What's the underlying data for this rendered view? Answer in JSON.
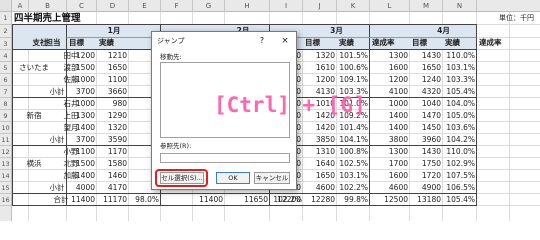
{
  "columns": [
    "A",
    "B",
    "C",
    "D",
    "E",
    "F",
    "G",
    "H",
    "I",
    "J",
    "K",
    "L",
    "M",
    "N"
  ],
  "row_numbers": [
    "1",
    "2",
    "3",
    "4",
    "5",
    "6",
    "7",
    "8",
    "9",
    "10",
    "11",
    "12",
    "13",
    "14",
    "15",
    "16"
  ],
  "sheet": {
    "title": "四半期売上管理",
    "unit": "単位：千円",
    "headers": {
      "branch": "支社",
      "person": "担当",
      "months": [
        "1月",
        "2月",
        "3月",
        "4月"
      ],
      "target": "目標",
      "actual": "実績",
      "rate": "達成率"
    },
    "rows": [
      {
        "branch": "",
        "person": "田中",
        "jan": [
          "1200",
          "1210"
        ],
        "mar": [
          "1300",
          "1320",
          "101.5%"
        ],
        "apr": [
          "1300",
          "1430",
          "110.0%"
        ]
      },
      {
        "branch": "さいたま",
        "person": "渡部",
        "jan": [
          "1500",
          "1650"
        ],
        "mar": [
          "1600",
          "1610",
          "100.6%"
        ],
        "apr": [
          "1600",
          "1650",
          "103.1%"
        ]
      },
      {
        "branch": "",
        "person": "佐藤",
        "jan": [
          "1000",
          "1100"
        ],
        "mar": [
          "1100",
          "1200",
          "109.1%"
        ],
        "apr": [
          "1200",
          "1240",
          "103.3%"
        ]
      },
      {
        "branch": "",
        "person": "小計",
        "jan": [
          "3700",
          "3660"
        ],
        "mar": [
          "4000",
          "4130",
          "103.3%"
        ],
        "apr": [
          "4100",
          "4320",
          "105.4%"
        ]
      },
      {
        "branch": "",
        "person": "石井",
        "jan": [
          "1000",
          "980"
        ],
        "mar": [
          "1000",
          "1010",
          "101.0%"
        ],
        "apr": [
          "1000",
          "1040",
          "104.0%"
        ]
      },
      {
        "branch": "新宿",
        "person": "上田",
        "jan": [
          "1300",
          "1290"
        ],
        "mar": [
          "1300",
          "1420",
          "109.2%"
        ],
        "apr": [
          "1400",
          "1470",
          "105.0%"
        ]
      },
      {
        "branch": "",
        "person": "望月",
        "jan": [
          "1400",
          "1320"
        ],
        "mar": [
          "1400",
          "1420",
          "101.4%"
        ],
        "apr": [
          "1400",
          "1450",
          "103.6%"
        ]
      },
      {
        "branch": "",
        "person": "小計",
        "jan": [
          "3700",
          "3590"
        ],
        "mar": [
          "3700",
          "3850",
          "104.1%"
        ],
        "apr": [
          "3800",
          "3960",
          "104.2%"
        ]
      },
      {
        "branch": "",
        "person": "小野",
        "jan": [
          "1100",
          "1170"
        ],
        "mar": [
          "1300",
          "1310",
          "100.8%"
        ],
        "apr": [
          "1300",
          "1430",
          "110.0%"
        ]
      },
      {
        "branch": "横浜",
        "person": "北野",
        "jan": [
          "1500",
          "1580"
        ],
        "mar": [
          "1600",
          "1640",
          "102.5%"
        ],
        "apr": [
          "1700",
          "1750",
          "102.9%"
        ]
      },
      {
        "branch": "",
        "person": "加藤",
        "jan": [
          "1400",
          "1460"
        ],
        "mar": [
          "1600",
          "1650",
          "103.1%"
        ],
        "apr": [
          "1600",
          "1720",
          "107.5%"
        ]
      },
      {
        "branch": "",
        "person": "小計",
        "jan": [
          "4000",
          "4170"
        ],
        "mar": [
          "4500",
          "4600",
          "102.2%"
        ],
        "apr": [
          "4600",
          "4900",
          "106.5%"
        ]
      },
      {
        "branch": "",
        "person": "合計",
        "jan": [
          "11400",
          "11170",
          "98.0%"
        ],
        "feb": [
          "11400",
          "11650",
          "102.2%"
        ],
        "mar": [
          "12200",
          "12280",
          "99.8%"
        ],
        "apr": [
          "12500",
          "13180",
          "105.4%"
        ]
      }
    ]
  },
  "dialog": {
    "title": "ジャンプ",
    "help": "?",
    "close": "×",
    "goto_label": "移動先:",
    "reference_label": "参照先(R):",
    "reference_value": "",
    "special_button": "セル選択(S)...",
    "ok_button": "OK",
    "cancel_button": "キャンセル"
  },
  "overlay": {
    "shortcut": "[Ctrl] + [G]"
  },
  "colors": {
    "header_blue": "#dce6f1",
    "grid": "#d4d4d4",
    "highlight_red": "#e0201c",
    "overlay_pink": "#ff66ad"
  }
}
